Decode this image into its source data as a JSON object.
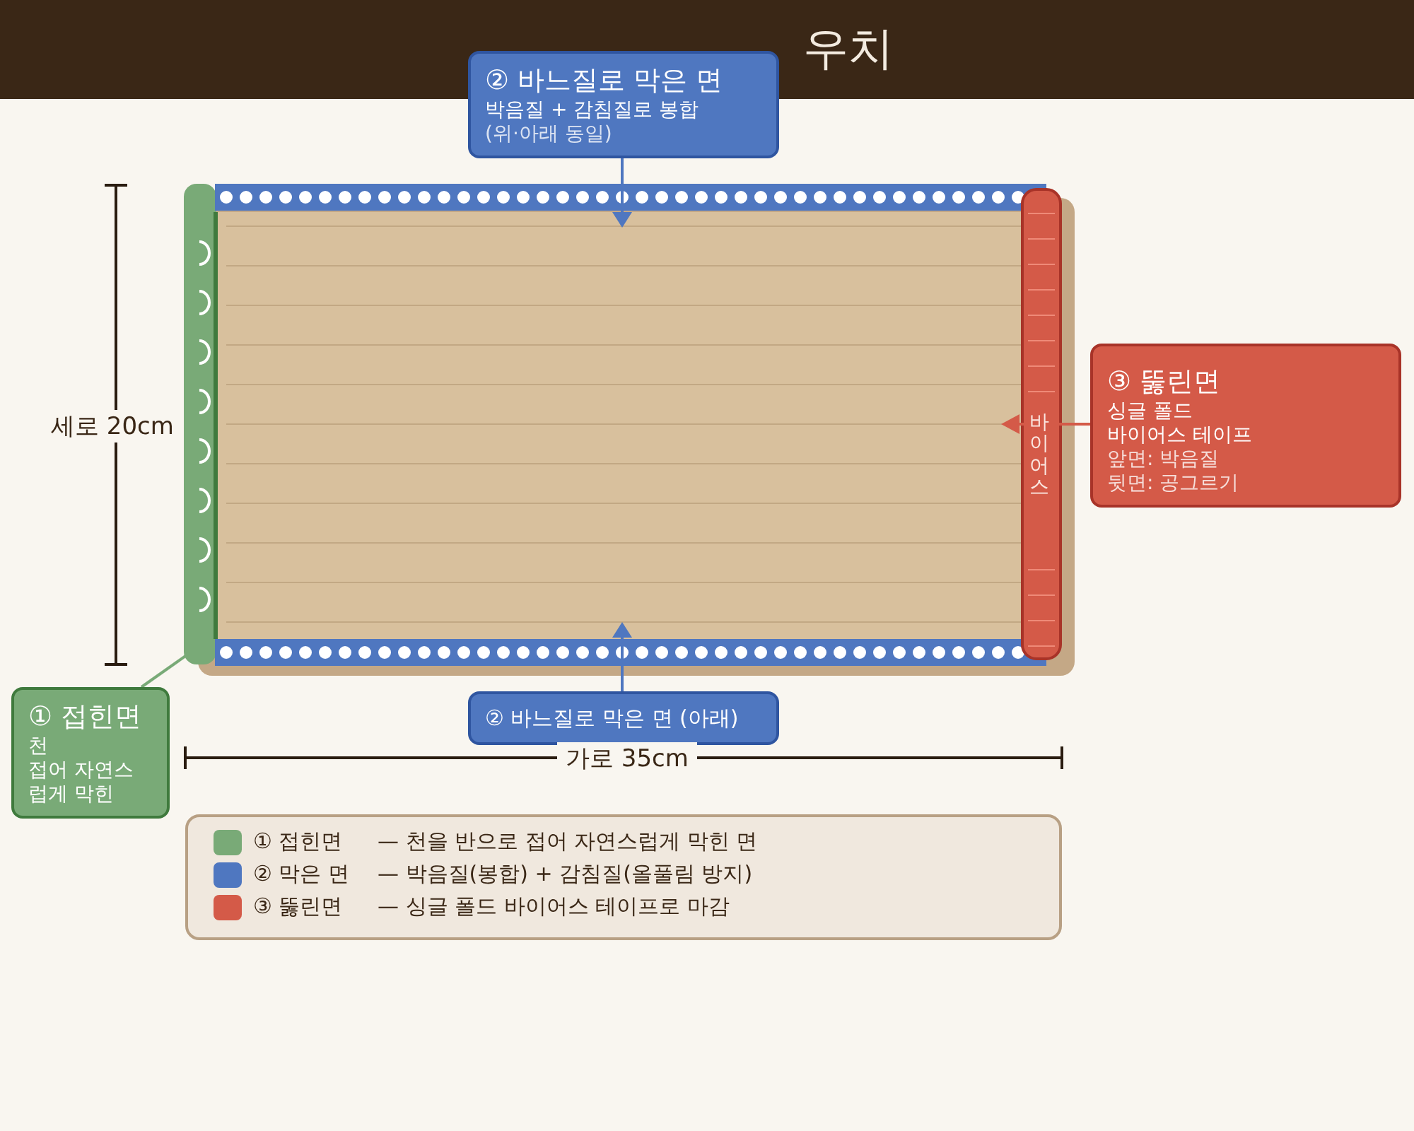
{
  "header": {
    "title": "우치"
  },
  "callouts": [
    {
      "kind": "folded",
      "title": "① 접힌면",
      "lines": [
        "천",
        "접어 자연스",
        "럽게 막힌"
      ]
    },
    {
      "kind": "sewn-top",
      "title": "② 바느질로 막은 면",
      "lines": [
        "박음질 + 감침질로 봉합",
        "(위·아래 동일)"
      ]
    },
    {
      "kind": "sewn-bottom",
      "title": "② 바느질로 막은 면 (아래)"
    },
    {
      "kind": "open",
      "title": "③ 뚫린면",
      "lines": [
        "싱글 폴드",
        "바이어스 테이프",
        "앞면: 박음질",
        "뒷면: 공그르기"
      ]
    }
  ],
  "pouch": {
    "tape_label": "바이어스"
  },
  "dimensions": {
    "width": "가로 35cm",
    "height": "세로 20cm"
  },
  "legend": [
    {
      "color": "#79aa77",
      "label": "① 접힌면",
      "description": "— 천을 반으로 접어 자연스럽게 막힌 면"
    },
    {
      "color": "#4f77c0",
      "label": "② 막은 면",
      "description": "— 박음질(봉합) + 감침질(올풀림 방지)"
    },
    {
      "color": "#d45a48",
      "label": "③ 뚫린면",
      "description": "— 싱글 폴드 바이어스 테이프로 마감"
    }
  ]
}
